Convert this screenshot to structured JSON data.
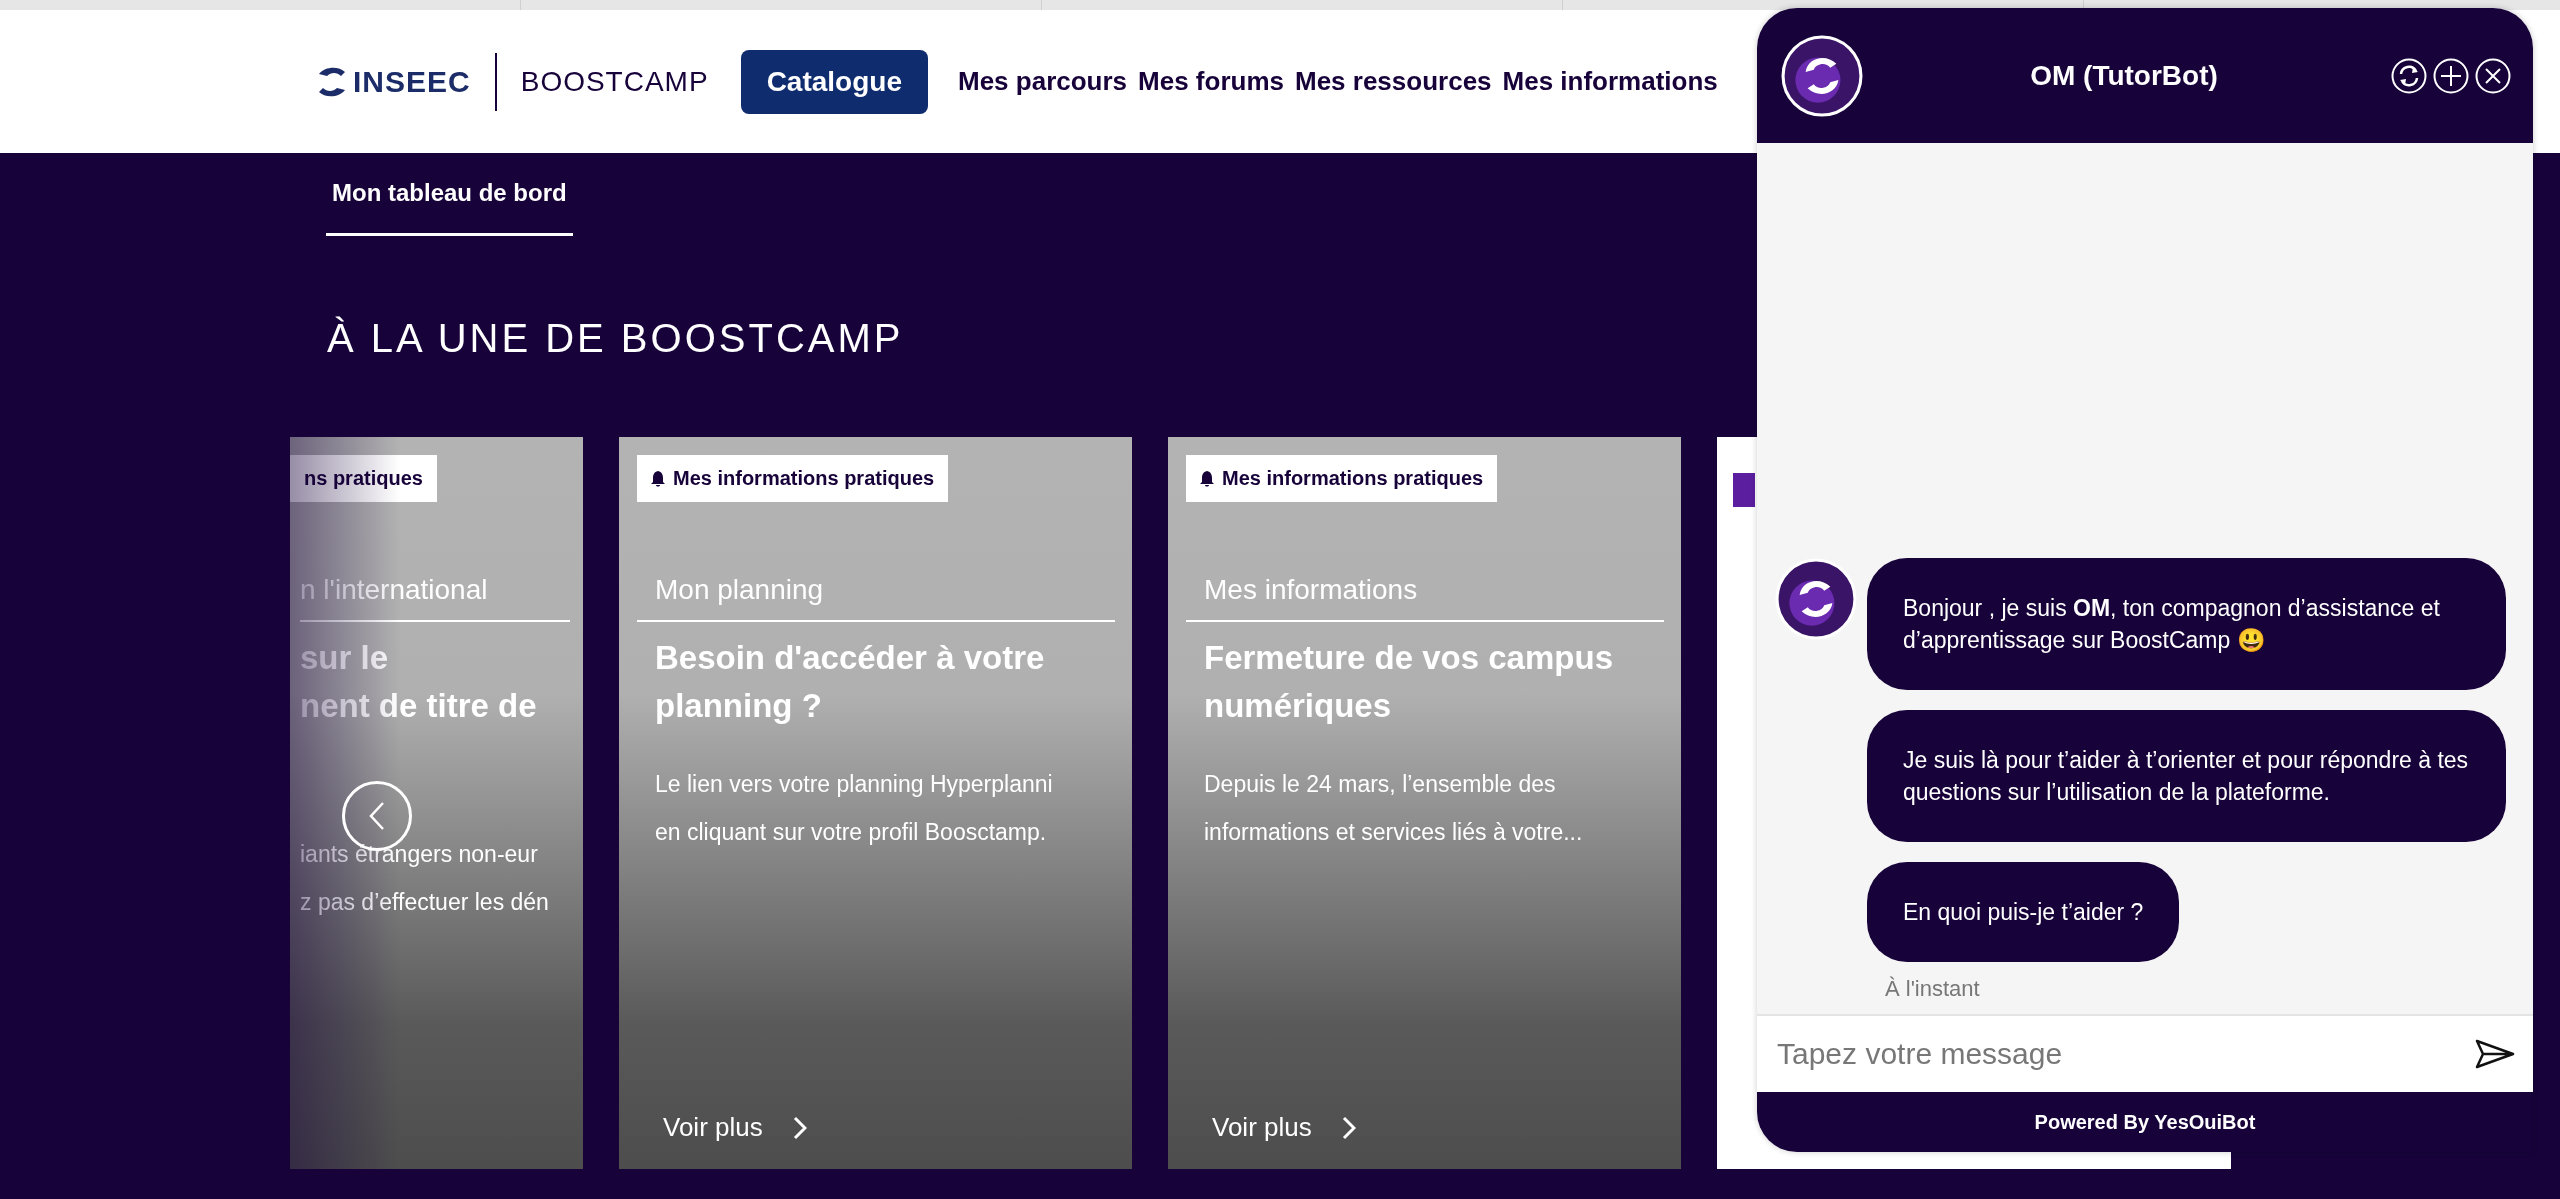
{
  "header": {
    "brand": "INSEEC",
    "product": "BOOSTCAMP",
    "catalogue_button": "Catalogue",
    "nav": [
      "Mes parcours",
      "Mes forums",
      "Mes ressources",
      "Mes informations"
    ]
  },
  "tabs": [
    {
      "label": "Mon tableau de bord",
      "selected": true
    }
  ],
  "section_title": "À LA UNE DE BOOSTCAMP",
  "carousel": {
    "cards": [
      {
        "kind": "partial",
        "tag": "ns pratiques",
        "category": "n l'international",
        "title": [
          "sur le",
          "nent de titre de"
        ],
        "body": [
          "iants étrangers non-eur",
          "z pas d’effectuer les dén"
        ]
      },
      {
        "kind": "article",
        "tag": "Mes informations pratiques",
        "category": "Mon planning",
        "title": [
          "Besoin d'accéder à votre",
          "planning ?"
        ],
        "body": [
          "Le lien vers votre planning Hyperplanni",
          "en cliquant sur votre profil Boosctamp."
        ],
        "link": "Voir plus"
      },
      {
        "kind": "article",
        "tag": "Mes informations pratiques",
        "category": "Mes informations",
        "title": [
          "Fermeture de vos campus",
          "numériques"
        ],
        "body": [
          "Depuis le 24 mars, l’ensemble des",
          "informations et services liés à votre..."
        ],
        "link": "Voir plus"
      },
      {
        "kind": "hidden"
      }
    ]
  },
  "chat": {
    "title": "OM (TutorBot)",
    "messages": [
      "Bonjour , je suis **OM**, ton compagnon d’assistance et d’apprentissage sur BoostCamp 😃",
      "Je suis là pour t’aider à t’orienter et pour répondre à tes questions sur l’utilisation de la plateforme.",
      "En quoi puis-je t’aider ?"
    ],
    "timestamp": "À l'instant",
    "input": {
      "placeholder": "Tapez votre message"
    },
    "footer": "Powered By YesOuiBot"
  }
}
